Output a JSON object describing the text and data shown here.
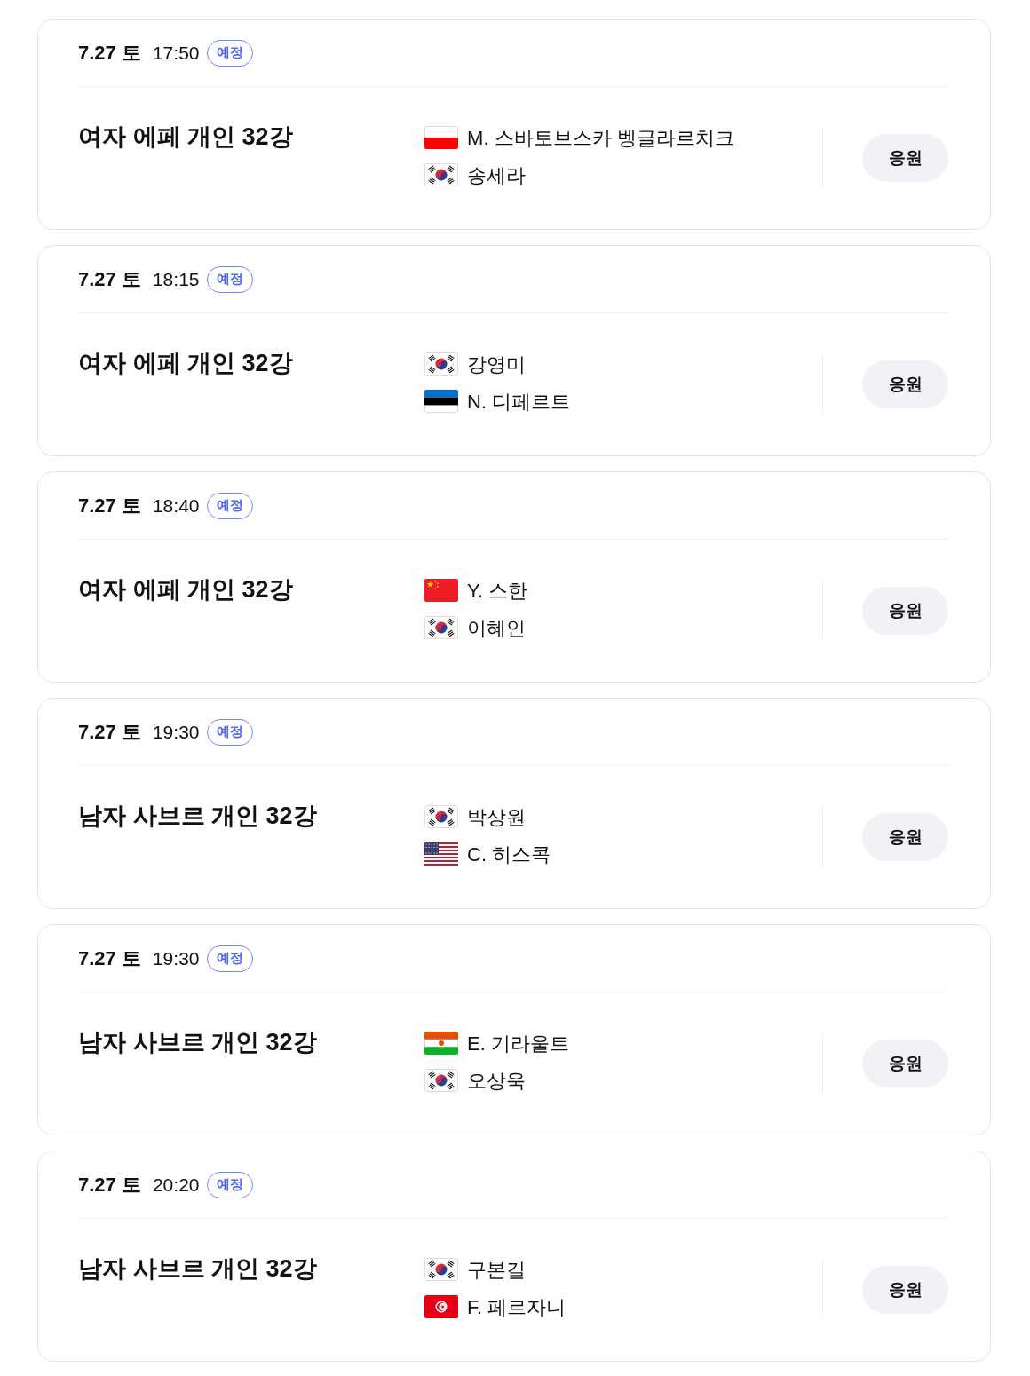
{
  "matches": [
    {
      "date": "7.27 토",
      "time": "17:50",
      "status": "예정",
      "event": "여자 에페 개인 32강",
      "players": [
        {
          "kind": "poland",
          "name": "M. 스바토브스카 벵글라르치크"
        },
        {
          "kind": "korea",
          "name": "송세라"
        }
      ],
      "button": "응원"
    },
    {
      "date": "7.27 토",
      "time": "18:15",
      "status": "예정",
      "event": "여자 에페 개인 32강",
      "players": [
        {
          "kind": "korea",
          "name": "강영미"
        },
        {
          "kind": "estonia",
          "name": "N. 디페르트"
        }
      ],
      "button": "응원"
    },
    {
      "date": "7.27 토",
      "time": "18:40",
      "status": "예정",
      "event": "여자 에페 개인 32강",
      "players": [
        {
          "kind": "china",
          "name": "Y. 스한"
        },
        {
          "kind": "korea",
          "name": "이혜인"
        }
      ],
      "button": "응원"
    },
    {
      "date": "7.27 토",
      "time": "19:30",
      "status": "예정",
      "event": "남자 사브르 개인 32강",
      "players": [
        {
          "kind": "korea",
          "name": "박상원"
        },
        {
          "kind": "usa",
          "name": "C. 히스콕"
        }
      ],
      "button": "응원"
    },
    {
      "date": "7.27 토",
      "time": "19:30",
      "status": "예정",
      "event": "남자 사브르 개인 32강",
      "players": [
        {
          "kind": "niger",
          "name": "E. 기라울트"
        },
        {
          "kind": "korea",
          "name": "오상욱"
        }
      ],
      "button": "응원"
    },
    {
      "date": "7.27 토",
      "time": "20:20",
      "status": "예정",
      "event": "남자 사브르 개인 32강",
      "players": [
        {
          "kind": "korea",
          "name": "구본길"
        },
        {
          "kind": "tunisia",
          "name": "F. 페르자니"
        }
      ],
      "button": "응원"
    }
  ]
}
